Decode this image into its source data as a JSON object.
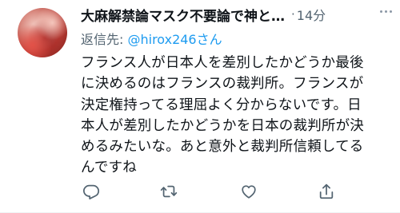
{
  "tweet": {
    "author_name": "大麻解禁論マスク不要論で神と…",
    "separator": "·",
    "time": "14分",
    "reply_prefix": "返信先: ",
    "reply_handle": "@hirox246",
    "reply_suffix": "さん",
    "body_lines": [
      "フランス人が日本人を差別したかどうか最後",
      "に決めるのはフランスの裁判所。フランスが",
      "決定権持ってる理屈よく分からないです。日",
      "本人が差別したかどうかを日本の裁判所が決",
      "めるみたいな。あと意外と裁判所信頼してる",
      "んですね"
    ]
  },
  "actions": [
    {
      "icon": "reply-icon"
    },
    {
      "icon": "retweet-icon"
    },
    {
      "icon": "like-icon"
    },
    {
      "icon": "share-icon"
    }
  ],
  "colors": {
    "text": "#0f1419",
    "secondary": "#536471",
    "link": "#1d9bf0"
  }
}
